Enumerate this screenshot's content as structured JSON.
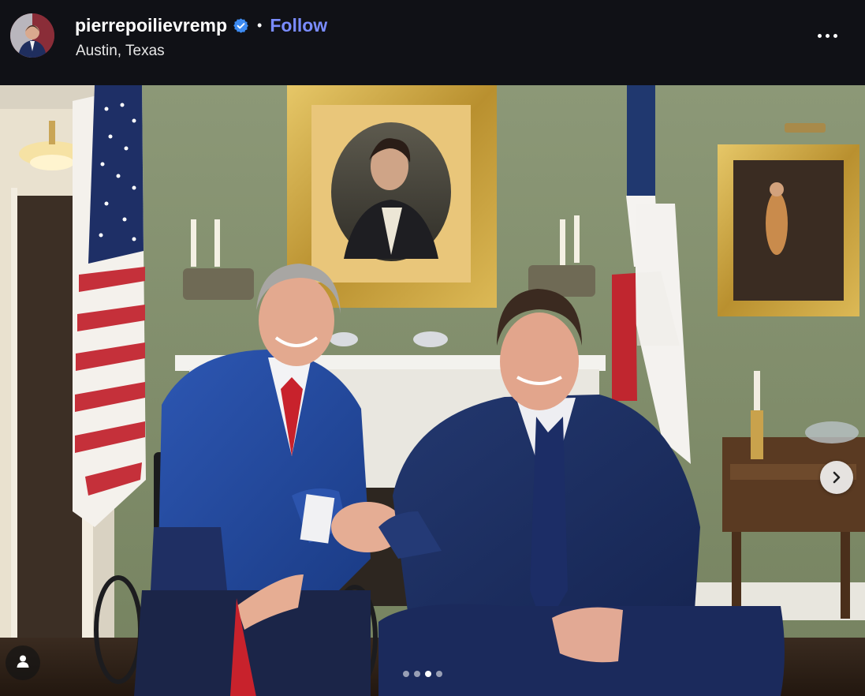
{
  "post": {
    "username": "pierrepoilievremp",
    "separator": "•",
    "follow_label": "Follow",
    "location": "Austin, Texas",
    "verified": true
  },
  "carousel": {
    "slide_count": 4,
    "active_index": 2
  },
  "icons": {
    "verified": "verified-badge-icon",
    "more": "more-options-icon",
    "next": "chevron-right-icon",
    "tag": "user-tag-icon"
  },
  "colors": {
    "header_bg": "#101116",
    "follow": "#7a8cff",
    "verified": "#3d8bf2"
  }
}
